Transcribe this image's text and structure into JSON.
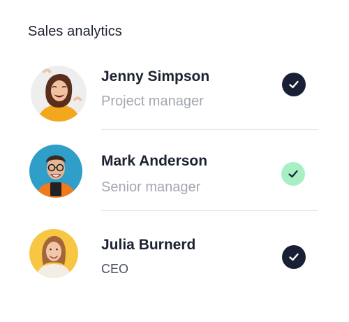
{
  "section": {
    "title": "Sales analytics"
  },
  "people": [
    {
      "name": "Jenny Simpson",
      "role": "Project manager",
      "status": "checked",
      "avatar_bg": "#f0efee",
      "check_bg": "#192036",
      "check_color": "#ffffff"
    },
    {
      "name": "Mark Anderson",
      "role": "Senior manager",
      "status": "checked",
      "avatar_bg": "#2f9ec9",
      "check_bg": "#a8f0c4",
      "check_color": "#18223a"
    },
    {
      "name": "Julia Burnerd",
      "role": "CEO",
      "status": "checked",
      "avatar_bg": "#f7c744",
      "check_bg": "#192036",
      "check_color": "#ffffff"
    }
  ],
  "icons": {
    "status": "check-icon"
  }
}
